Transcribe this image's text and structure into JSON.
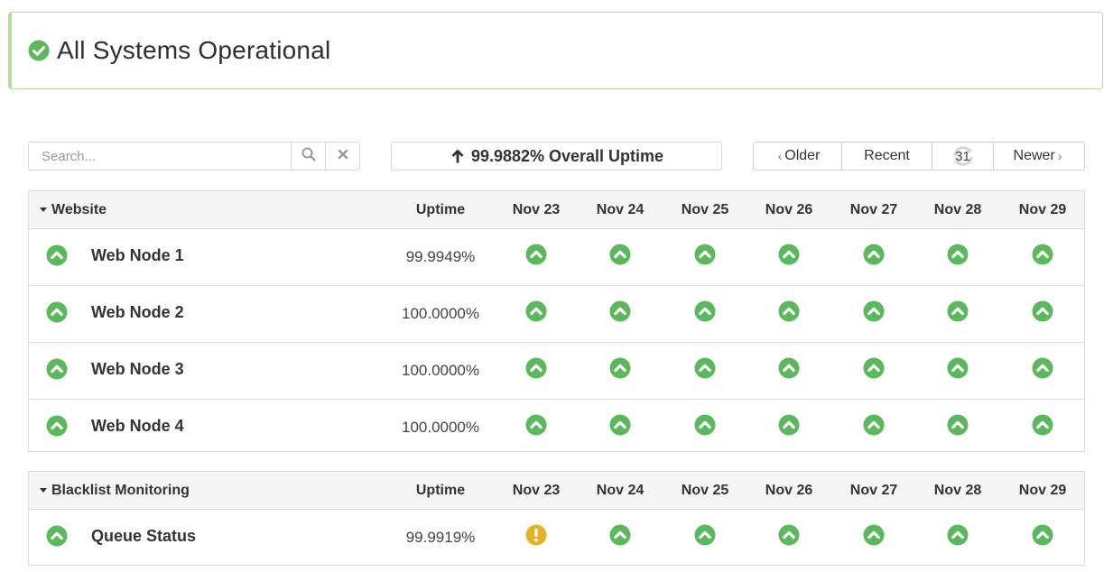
{
  "banner": {
    "title": "All Systems Operational",
    "icon": "check-circle-icon",
    "color": "#5cb85c"
  },
  "toolbar": {
    "search_placeholder": "Search...",
    "search_value": "",
    "overall_uptime": "99.9882% Overall Uptime",
    "pager": {
      "older": "Older",
      "recent": "Recent",
      "calendar_day": "31",
      "newer": "Newer"
    }
  },
  "columns": {
    "uptime": "Uptime",
    "days": [
      "Nov 23",
      "Nov 24",
      "Nov 25",
      "Nov 26",
      "Nov 27",
      "Nov 28",
      "Nov 29"
    ]
  },
  "colors": {
    "up": "#5cb85c",
    "warning": "#e3b227"
  },
  "groups": [
    {
      "name": "Website",
      "rows": [
        {
          "name": "Web Node 1",
          "uptime": "99.9949%",
          "status": "up",
          "days": [
            "up",
            "up",
            "up",
            "up",
            "up",
            "up",
            "up"
          ]
        },
        {
          "name": "Web Node 2",
          "uptime": "100.0000%",
          "status": "up",
          "days": [
            "up",
            "up",
            "up",
            "up",
            "up",
            "up",
            "up"
          ]
        },
        {
          "name": "Web Node 3",
          "uptime": "100.0000%",
          "status": "up",
          "days": [
            "up",
            "up",
            "up",
            "up",
            "up",
            "up",
            "up"
          ]
        },
        {
          "name": "Web Node 4",
          "uptime": "100.0000%",
          "status": "up",
          "days": [
            "up",
            "up",
            "up",
            "up",
            "up",
            "up",
            "up"
          ]
        }
      ]
    },
    {
      "name": "Blacklist Monitoring",
      "rows": [
        {
          "name": "Queue Status",
          "uptime": "99.9919%",
          "status": "up",
          "days": [
            "warning",
            "up",
            "up",
            "up",
            "up",
            "up",
            "up"
          ]
        }
      ]
    }
  ]
}
